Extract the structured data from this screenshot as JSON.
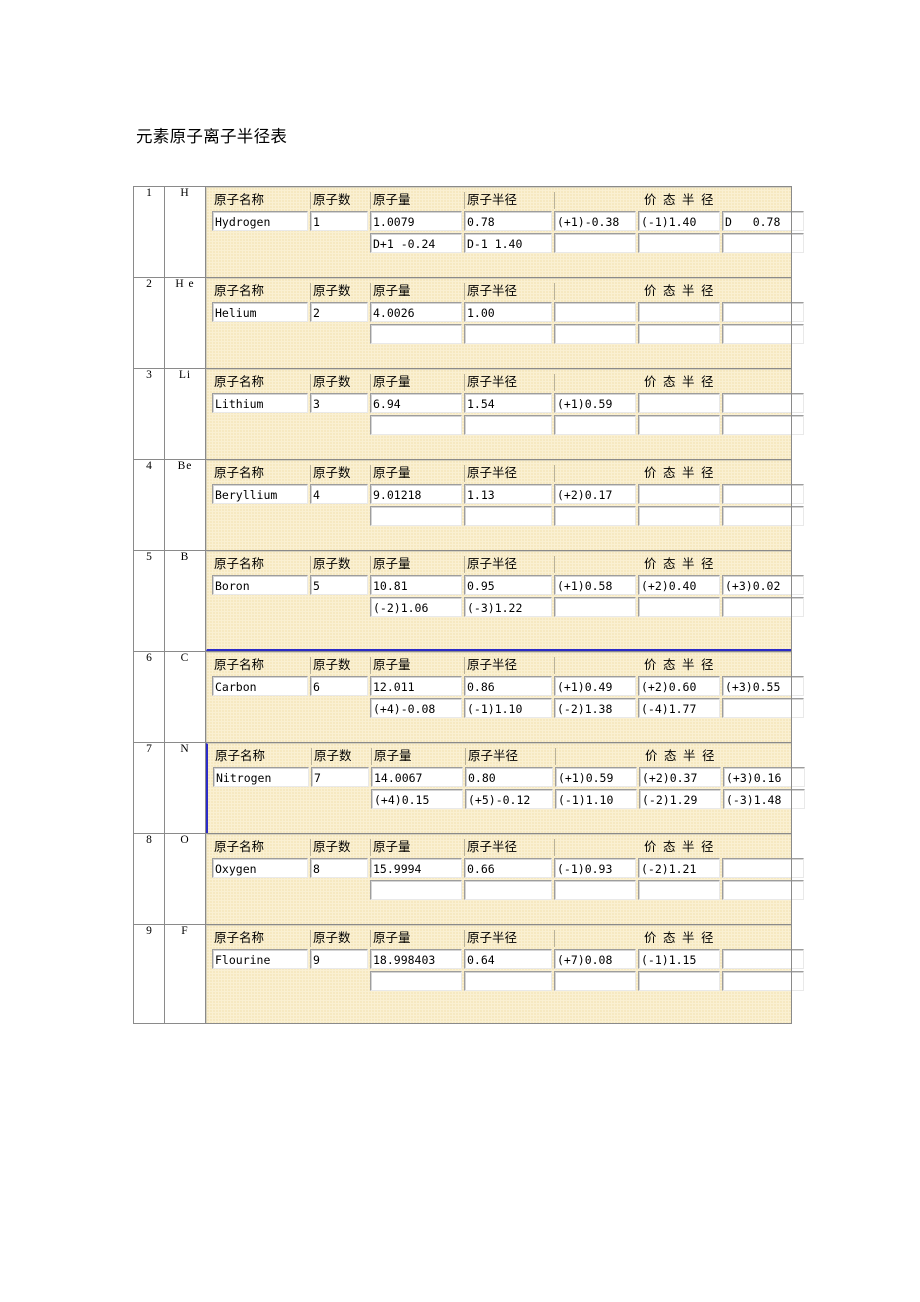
{
  "document": {
    "title": "元素原子离子半径表"
  },
  "table": {
    "headers": {
      "name": "原子名称",
      "count": "原子数",
      "mass": "原子量",
      "radius": "原子半径",
      "valence": "价 态 半 径"
    },
    "rows": [
      {
        "number": "1",
        "symbol": "H",
        "name": "Hydrogen",
        "count": "1",
        "mass": "1.0079",
        "radius": "0.78",
        "valence1": "(+1)-0.38",
        "valence2": "(-1)1.40",
        "valence3": "D   0.78",
        "mass2": "D+1 -0.24",
        "radius2": "D-1 1.40",
        "valence4": "",
        "valence5": "",
        "valence6": "",
        "style": "normal"
      },
      {
        "number": "2",
        "symbol": "H e",
        "name": "Helium",
        "count": "2",
        "mass": "4.0026",
        "radius": "1.00",
        "valence1": "",
        "valence2": "",
        "valence3": "",
        "mass2": "",
        "radius2": "",
        "valence4": "",
        "valence5": "",
        "valence6": "",
        "style": "normal"
      },
      {
        "number": "3",
        "symbol": "Li",
        "name": "Lithium",
        "count": "3",
        "mass": "6.94",
        "radius": "1.54",
        "valence1": "(+1)0.59",
        "valence2": "",
        "valence3": "",
        "mass2": "",
        "radius2": "",
        "valence4": "",
        "valence5": "",
        "valence6": "",
        "style": "normal"
      },
      {
        "number": "4",
        "symbol": "Be",
        "name": "Beryllium",
        "count": "4",
        "mass": "9.01218",
        "radius": "1.13",
        "valence1": "(+2)0.17",
        "valence2": "",
        "valence3": "",
        "mass2": "",
        "radius2": "",
        "valence4": "",
        "valence5": "",
        "valence6": "",
        "style": "normal"
      },
      {
        "number": "5",
        "symbol": "B",
        "name": "Boron",
        "count": "5",
        "mass": "10.81",
        "radius": "0.95",
        "valence1": "(+1)0.58",
        "valence2": "(+2)0.40",
        "valence3": "(+3)0.02",
        "mass2": "(-2)1.06",
        "radius2": "(-3)1.22",
        "valence4": "",
        "valence5": "",
        "valence6": "",
        "style": "blue-bottom"
      },
      {
        "number": "6",
        "symbol": "C",
        "name": "Carbon",
        "count": "6",
        "mass": "12.011",
        "radius": "0.86",
        "valence1": "(+1)0.49",
        "valence2": "(+2)0.60",
        "valence3": "(+3)0.55",
        "mass2": "(+4)-0.08",
        "radius2": "(-1)1.10",
        "valence4": "(-2)1.38",
        "valence5": "(-4)1.77",
        "valence6": "",
        "style": "normal"
      },
      {
        "number": "7",
        "symbol": "N",
        "name": "Nitrogen",
        "count": "7",
        "mass": "14.0067",
        "radius": "0.80",
        "valence1": "(+1)0.59",
        "valence2": "(+2)0.37",
        "valence3": "(+3)0.16",
        "mass2": "(+4)0.15",
        "radius2": "(+5)-0.12",
        "valence4": "(-1)1.10",
        "valence5": "(-2)1.29",
        "valence6": "(-3)1.48",
        "style": "blue-left"
      },
      {
        "number": "8",
        "symbol": "O",
        "name": "Oxygen",
        "count": "8",
        "mass": "15.9994",
        "radius": "0.66",
        "valence1": "(-1)0.93",
        "valence2": "(-2)1.21",
        "valence3": "",
        "mass2": "",
        "radius2": "",
        "valence4": "",
        "valence5": "",
        "valence6": "",
        "style": "normal"
      },
      {
        "number": "9",
        "symbol": "F",
        "name": "Flourine",
        "count": "9",
        "mass": "18.998403",
        "radius": "0.64",
        "valence1": "(+7)0.08",
        "valence2": "(-1)1.15",
        "valence3": "",
        "mass2": "",
        "radius2": "",
        "valence4": "",
        "valence5": "",
        "valence6": "",
        "style": "last"
      }
    ]
  },
  "colors": {
    "panel_background": "#faf0d2",
    "panel_dots": "#e9cd82",
    "accent_blue": "#2b2bc8",
    "table_border": "#8a8a8a",
    "text": "#000000"
  }
}
